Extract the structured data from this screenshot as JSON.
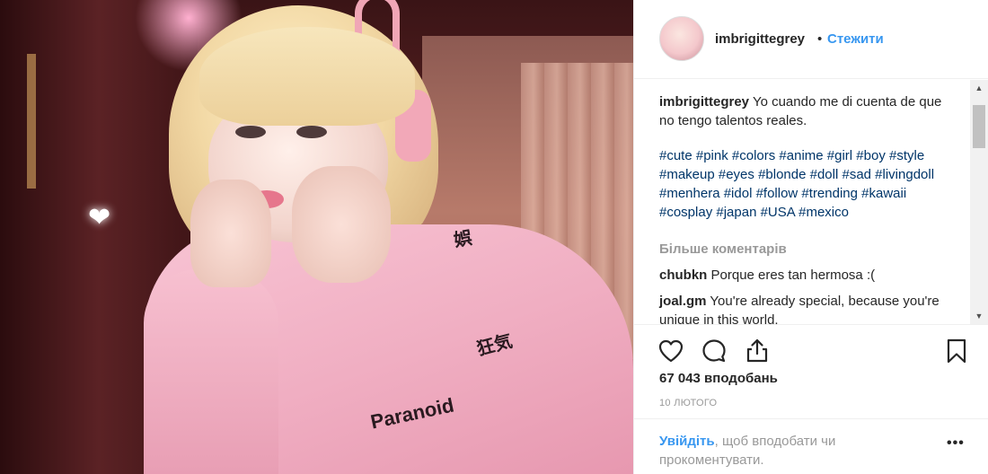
{
  "post": {
    "username": "imbrigittegrey",
    "separator": "•",
    "follow_label": "Стежити",
    "caption_user": "imbrigittegrey",
    "caption_text": "Yo cuando me di cuenta de que no tengo talentos reales.",
    "hashtags": "#cute #pink #colors #anime #girl #boy #style #makeup #eyes #blonde #doll #sad #livingdoll #menhera #idol #follow #trending #kawaii #cosplay #japan #USA #mexico",
    "more_comments_label": "Більше коментарів",
    "comments": [
      {
        "user": "chubkn",
        "text": "Porque eres tan hermosa :("
      },
      {
        "user": "joal.gm",
        "text": "You're already special, because you're unique in this world."
      }
    ],
    "likes": "67 043 вподобань",
    "date": "10 ЛЮТОГО",
    "login_link": "Увійдіть",
    "login_text": ", щоб вподобати чи прокоментувати.",
    "options": "•••"
  },
  "icons": {
    "like": "heart-outline-icon",
    "comment": "comment-bubble-icon",
    "share": "share-icon",
    "save": "bookmark-icon",
    "more": "more-options-icon"
  },
  "scrollbar": {
    "up": "▲",
    "down": "▼"
  },
  "photo": {
    "heart": "❤",
    "print_1": "Paranoid",
    "print_2": "狂気",
    "print_3": "娯"
  },
  "colors": {
    "link": "#3897f0",
    "hashtag": "#003569",
    "muted": "#999999",
    "text": "#262626"
  }
}
